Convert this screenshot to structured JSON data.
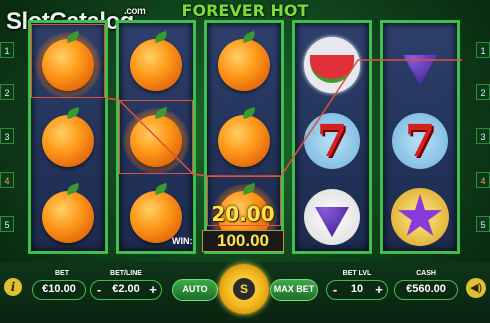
{
  "watermark": {
    "text": "SlotCatalog",
    "suffix": ".com"
  },
  "title": "FOREVER HOT",
  "paylines_left": [
    "1",
    "2",
    "3",
    "4",
    "5"
  ],
  "paylines_right": [
    "1",
    "2",
    "3",
    "4",
    "5"
  ],
  "reels": [
    [
      "orange-burning",
      "orange",
      "orange"
    ],
    [
      "orange",
      "orange-burning",
      "orange"
    ],
    [
      "orange",
      "orange",
      "orange-burning"
    ],
    [
      "watermelon",
      "seven",
      "grapes"
    ],
    [
      "grapes",
      "seven",
      "star"
    ]
  ],
  "win": {
    "line_win": "20.00",
    "label": "WIN:",
    "total": "100.00"
  },
  "controls": {
    "bet_label": "BET",
    "bet_value": "€10.00",
    "betline_label": "BET/LINE",
    "betline_value": "€2.00",
    "auto_label": "AUTO",
    "spin_label": "S",
    "maxbet_label": "MAX BET",
    "betlvl_label": "BET LVL",
    "betlvl_value": "10",
    "cash_label": "CASH",
    "cash_value": "€560.00",
    "minus": "-",
    "plus": "+",
    "info": "i",
    "sound": "◀)"
  },
  "colors": {
    "reel_border": "#3fbf4d",
    "win_text": "#ffe14a",
    "payline": "#e0503a"
  }
}
